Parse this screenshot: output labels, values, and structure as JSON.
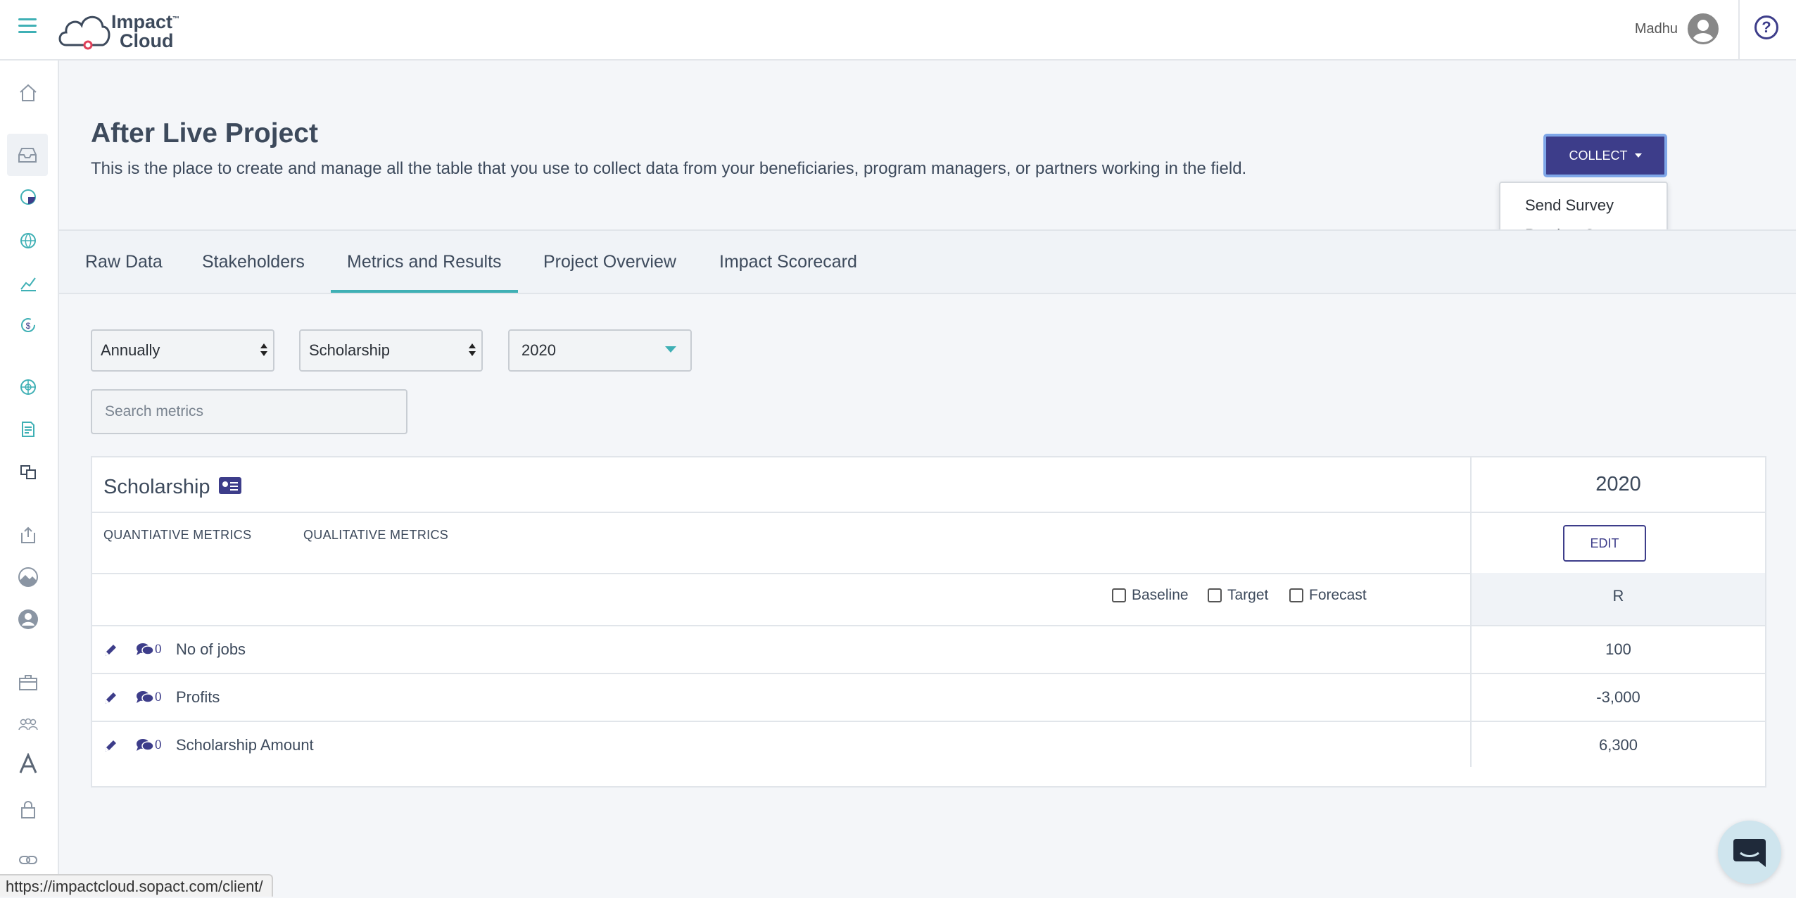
{
  "header": {
    "logo_line1": "Impact",
    "logo_tm": "™",
    "logo_line2": "Cloud",
    "user_name": "Madhu",
    "help_symbol": "?"
  },
  "sidebar": {
    "items": [
      {
        "icon": "home-icon"
      },
      {
        "icon": "inbox-icon",
        "active": true
      },
      {
        "icon": "pie-chart-icon"
      },
      {
        "icon": "globe-icon"
      },
      {
        "icon": "line-chart-icon"
      },
      {
        "icon": "dollar-cycle-icon"
      },
      {
        "icon": "network-globe-icon"
      },
      {
        "icon": "document-icon"
      },
      {
        "icon": "translate-icon"
      },
      {
        "icon": "upload-icon"
      },
      {
        "icon": "landscape-icon"
      },
      {
        "icon": "user-circle-icon"
      },
      {
        "icon": "briefcase-icon"
      },
      {
        "icon": "team-icon"
      },
      {
        "icon": "font-icon"
      },
      {
        "icon": "lock-icon"
      },
      {
        "icon": "link-icon"
      }
    ]
  },
  "page": {
    "title": "After Live Project",
    "description": "This is the place to create and manage all the table that you use to collect data from your beneficiaries, program managers, or partners working in the field."
  },
  "collect": {
    "label": "COLLECT",
    "menu": [
      "Send Survey",
      "Preview Survey"
    ]
  },
  "tabs": [
    "Raw Data",
    "Stakeholders",
    "Metrics and Results",
    "Project Overview",
    "Impact Scorecard"
  ],
  "active_tab": "Metrics and Results",
  "filters": {
    "period": "Annually",
    "category": "Scholarship",
    "year": "2020",
    "search_placeholder": "Search metrics"
  },
  "table": {
    "title": "Scholarship",
    "year": "2020",
    "quant_tab": "QUANTIATIVE METRICS",
    "qual_tab": "QUALITATIVE METRICS",
    "edit_label": "EDIT",
    "checkboxes": [
      "Baseline",
      "Target",
      "Forecast"
    ],
    "column_r": "R",
    "rows": [
      {
        "label": "No of jobs",
        "comments": "0",
        "value": "100"
      },
      {
        "label": "Profits",
        "comments": "0",
        "value": "-3,000"
      },
      {
        "label": "Scholarship Amount",
        "comments": "0",
        "value": "6,300"
      }
    ]
  },
  "status_url": "https://impactcloud.sopact.com/client/",
  "colors": {
    "primary": "#3d3d8a",
    "accent": "#3fb0b5",
    "text": "#3d4a5c"
  }
}
